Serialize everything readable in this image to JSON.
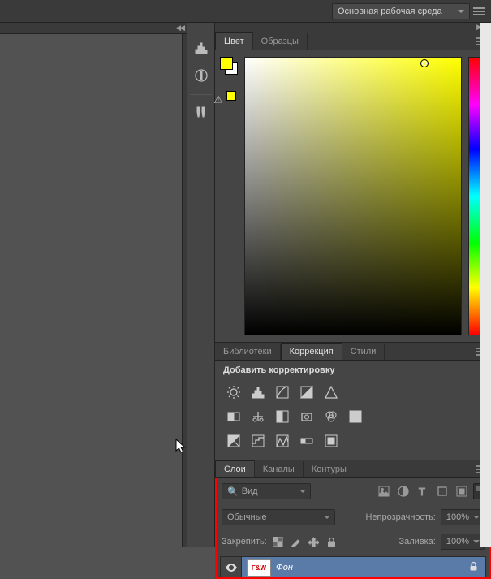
{
  "topbar": {
    "workspace": "Основная рабочая среда"
  },
  "color_panel": {
    "tabs": {
      "color": "Цвет",
      "swatches": "Образцы"
    },
    "active_tab": "color"
  },
  "adjustments_panel": {
    "tabs": {
      "libraries": "Библиотеки",
      "adjustments": "Коррекция",
      "styles": "Стили"
    },
    "title": "Добавить корректировку"
  },
  "layers_panel": {
    "tabs": {
      "layers": "Слои",
      "channels": "Каналы",
      "paths": "Контуры"
    },
    "filter_dd": "Вид",
    "blend_mode": "Обычные",
    "opacity_label": "Непрозрачность:",
    "opacity_value": "100%",
    "lock_label": "Закрепить:",
    "fill_label": "Заливка:",
    "fill_value": "100%",
    "layer": {
      "name": "Фон",
      "thumb_text": "F&W"
    }
  },
  "icons": {
    "search": "🔍"
  }
}
